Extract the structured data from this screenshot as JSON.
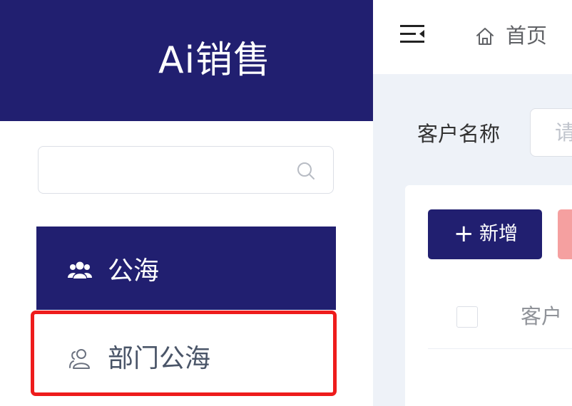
{
  "sidebar": {
    "logo": "Ai销售",
    "search": {
      "placeholder": "",
      "value": ""
    },
    "menu": [
      {
        "label": "公海",
        "icon": "users-group-icon",
        "active": true
      },
      {
        "label": "部门公海",
        "icon": "user-outline-icon",
        "active": false
      }
    ]
  },
  "topbar": {
    "breadcrumb_home": "首页"
  },
  "filter": {
    "customer_name_label": "客户名称",
    "customer_name_placeholder": "请"
  },
  "toolbar": {
    "add_label": "新增",
    "add_icon": "plus-icon"
  },
  "table": {
    "headers": [
      "客户"
    ]
  },
  "colors": {
    "brand": "#211f70",
    "highlight": "#ee1c1c",
    "danger_light": "#f5a0a0"
  }
}
